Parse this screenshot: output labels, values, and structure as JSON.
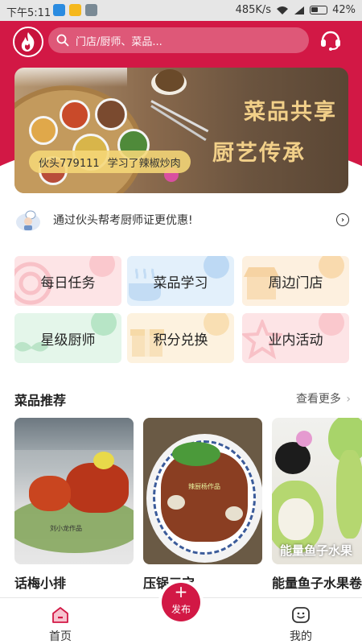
{
  "status_bar": {
    "time": "下午5:11",
    "network_speed": "485K/s",
    "battery": "42%"
  },
  "header": {
    "search_placeholder": "门店/厨师、菜品...",
    "brand_color": "#d21845"
  },
  "banner": {
    "title_line1": "菜品共享",
    "title_line2": "厨艺传承",
    "ticker": {
      "user": "伙头779111",
      "action": "学习了辣椒炒肉"
    }
  },
  "notice": {
    "text": "通过伙头帮考厨师证更优惠!"
  },
  "quick_tiles": [
    {
      "label": "每日任务",
      "color": "#fde4e6"
    },
    {
      "label": "菜品学习",
      "color": "#e3f0fb"
    },
    {
      "label": "周边门店",
      "color": "#fdf0df"
    },
    {
      "label": "星级厨师",
      "color": "#e4f6ea"
    },
    {
      "label": "积分兑换",
      "color": "#fdf2df"
    },
    {
      "label": "业内活动",
      "color": "#fde4e6"
    }
  ],
  "recommend": {
    "title": "菜品推荐",
    "more_label": "查看更多",
    "dishes": [
      {
        "name": "话梅小排",
        "watermark": "刘小龙作品"
      },
      {
        "name": "压锅三宝",
        "watermark": "辣厨杨作品"
      },
      {
        "name": "能量鱼子水果卷",
        "overlay": "能量鱼子水果"
      }
    ]
  },
  "bottom_nav": {
    "home": "首页",
    "publish": "发布",
    "mine": "我的"
  },
  "icons": [
    "flame-logo-icon",
    "search-icon",
    "customer-service-icon",
    "chevron-right-icon",
    "home-icon",
    "plus-icon",
    "smile-icon"
  ]
}
